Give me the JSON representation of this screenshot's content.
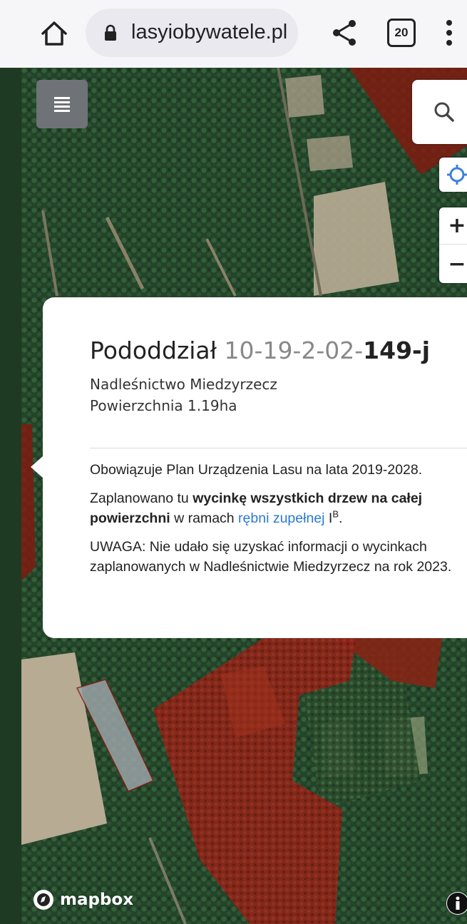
{
  "browser": {
    "url": "lasyiobywatele.pl",
    "tab_count": "20",
    "icons": {
      "home": "home-icon",
      "lock": "lock-icon",
      "share": "share-icon",
      "tabs": "tab-switcher-icon",
      "menu": "more-vert-icon"
    }
  },
  "map": {
    "controls": {
      "layers": "layers-menu-icon",
      "search": "search-icon",
      "geolocate": "geolocate-icon",
      "zoom_in": "+",
      "zoom_out": "−",
      "attribution": "info-icon"
    },
    "attribution_logo": "mapbox",
    "colors": {
      "forest_dark": "#1f3a22",
      "forest_mid": "#2f5230",
      "clearing": "#b7ab93",
      "planned_cut": "#8b1c12",
      "highlight_parcel": "#9aa3a6"
    }
  },
  "popup": {
    "title_word": "Pododdział",
    "code_prefix": "10-19-2-02-",
    "code_suffix": "149-j",
    "district": "Nadleśnictwo Miedzyrzecz",
    "area": "Powierzchnia 1.19ha",
    "plan_text": "Obowiązuje Plan Urządzenia Lasu na lata 2019-2028.",
    "planned_prefix": "Zaplanowano tu ",
    "planned_bold": "wycinkę wszystkich drzew na całej powierzchni",
    "planned_mid": " w ramach ",
    "planned_link": "rębni zupełnej",
    "planned_code": " I",
    "planned_sup": "B",
    "planned_end": ".",
    "warning": "UWAGA: Nie udało się uzyskać informacji o wycinkach zaplanowanych w Nadleśnictwie Miedzyrzecz na rok 2023."
  }
}
